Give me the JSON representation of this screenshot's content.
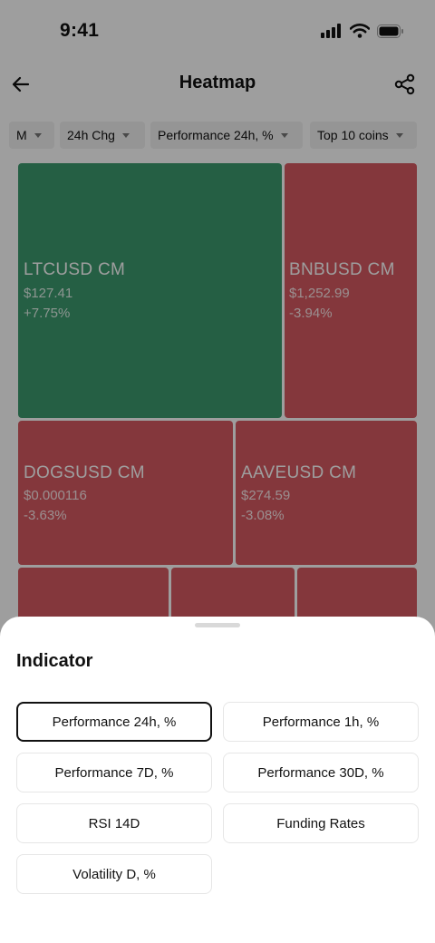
{
  "status_bar": {
    "time": "9:41"
  },
  "header": {
    "title": "Heatmap"
  },
  "filters": [
    {
      "label": "M"
    },
    {
      "label": "24h Chg"
    },
    {
      "label": "Performance 24h, %"
    },
    {
      "label": "Top 10 coins"
    }
  ],
  "heatmap": {
    "tiles": [
      {
        "symbol": "LTCUSD CM",
        "price": "$127.41",
        "change": "+7.75%",
        "direction": "up"
      },
      {
        "symbol": "BNBUSD CM",
        "price": "$1,252.99",
        "change": "-3.94%",
        "direction": "down"
      },
      {
        "symbol": "DOGSUSD CM",
        "price": "$0.000116",
        "change": "-3.63%",
        "direction": "down"
      },
      {
        "symbol": "AAVEUSD CM",
        "price": "$274.59",
        "change": "-3.08%",
        "direction": "down"
      }
    ],
    "colors": {
      "up": "#3d9a6f",
      "down": "#d65a62"
    }
  },
  "sheet": {
    "title": "Indicator",
    "options": [
      {
        "label": "Performance 24h, %",
        "selected": true
      },
      {
        "label": "Performance 1h, %",
        "selected": false
      },
      {
        "label": "Performance 7D, %",
        "selected": false
      },
      {
        "label": "Performance 30D, %",
        "selected": false
      },
      {
        "label": "RSI 14D",
        "selected": false
      },
      {
        "label": "Funding Rates",
        "selected": false
      },
      {
        "label": "Volatility D, %",
        "selected": false
      }
    ]
  }
}
